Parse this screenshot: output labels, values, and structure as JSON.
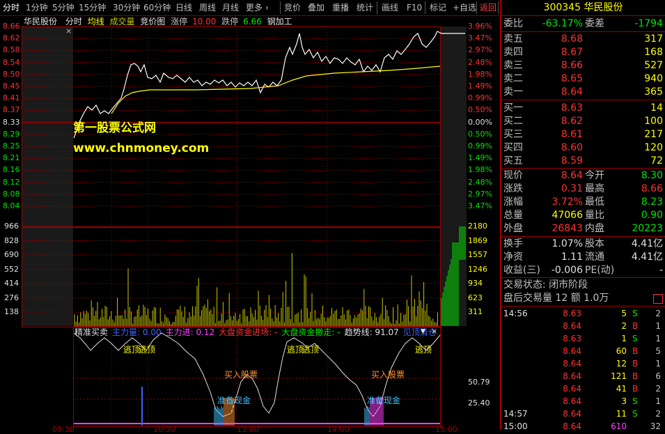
{
  "toolbar": {
    "items": [
      "分时",
      "1分钟",
      "5分钟",
      "15分钟",
      "30分钟",
      "60分钟",
      "日线",
      "周线",
      "月线",
      "更多 ›",
      "竞价",
      "叠加",
      "重播",
      "统计",
      "画线",
      "F10",
      "标记",
      "+自选",
      "返回"
    ]
  },
  "chart_header": {
    "name": "华民股份",
    "mode": "分时",
    "avg": "均线",
    "vol": "成交量",
    "auction": "竞价图",
    "limit_up_label": "涨停",
    "limit_up": "10.00",
    "limit_down_label": "跌停",
    "limit_down": "6.66",
    "sector": "钢加工"
  },
  "colors": {
    "up": "#ff3232",
    "down": "#00e600",
    "price_line": "#ffffff",
    "avg_line": "#ffff00",
    "grid": "#a00000",
    "volume": "#c8c800"
  },
  "watermark": {
    "line1": "第一股票公式网",
    "line2": "www.chnmoney.com"
  },
  "price_axis": {
    "left": [
      "8.66",
      "8.62",
      "8.58",
      "8.54",
      "8.50",
      "8.45",
      "8.41",
      "8.37",
      "8.33",
      "8.29",
      "8.25",
      "8.21",
      "8.16",
      "8.12",
      "8.08",
      "8.04"
    ],
    "right": [
      "3.96%",
      "3.47%",
      "2.97%",
      "2.48%",
      "1.98%",
      "1.49%",
      "0.99%",
      "0.50%",
      "0.00%",
      "0.50%",
      "0.99%",
      "1.49%",
      "1.98%",
      "2.48%",
      "2.97%",
      "3.47%"
    ]
  },
  "volume_axis": {
    "left": [
      "966",
      "828",
      "690",
      "552",
      "414",
      "276",
      "138"
    ],
    "right": [
      "2180",
      "1869",
      "1557",
      "1246",
      "934",
      "623",
      "311"
    ]
  },
  "indicator": {
    "name": "精准买卖",
    "items": [
      {
        "label": "主力量: 0.00",
        "color": "#4060ff"
      },
      {
        "label": "主力进: 0.12",
        "color": "#ff40ff"
      },
      {
        "label": "大盘资金进场: -",
        "color": "#ff3232"
      },
      {
        "label": "大盘资金撤走: -",
        "color": "#00e600"
      },
      {
        "label": "趋势线: 91.07",
        "color": "#e0e0e0"
      },
      {
        "label": "见顶清仓",
        "color": "#4060ff"
      }
    ],
    "axis_right": [
      "50.79",
      "25.40"
    ],
    "signals": {
      "escape": "逃顶",
      "buy": "买入股票",
      "ready": "准备现金"
    }
  },
  "time_axis": [
    "09:30",
    "10:30",
    "13:00",
    "14:00",
    "15:00"
  ],
  "quote": {
    "code": "300345",
    "name": "华民股份",
    "weibi_label": "委比",
    "weibi": "-63.17%",
    "weicha_label": "委差",
    "weicha": "-1794",
    "sells": [
      {
        "label": "卖五",
        "price": "8.68",
        "vol": "317"
      },
      {
        "label": "卖四",
        "price": "8.67",
        "vol": "168"
      },
      {
        "label": "卖三",
        "price": "8.66",
        "vol": "527"
      },
      {
        "label": "卖二",
        "price": "8.65",
        "vol": "940"
      },
      {
        "label": "卖一",
        "price": "8.64",
        "vol": "365"
      }
    ],
    "buys": [
      {
        "label": "买一",
        "price": "8.63",
        "vol": "14"
      },
      {
        "label": "买二",
        "price": "8.62",
        "vol": "100"
      },
      {
        "label": "买三",
        "price": "8.61",
        "vol": "217"
      },
      {
        "label": "买四",
        "price": "8.60",
        "vol": "120"
      },
      {
        "label": "买五",
        "price": "8.59",
        "vol": "72"
      }
    ],
    "stats": [
      {
        "l1": "现价",
        "v1": "8.64",
        "c1": "#ff3232",
        "l2": "今开",
        "v2": "8.30",
        "c2": "#00e600"
      },
      {
        "l1": "涨跌",
        "v1": "0.31",
        "c1": "#ff3232",
        "l2": "最高",
        "v2": "8.66",
        "c2": "#ff3232"
      },
      {
        "l1": "涨幅",
        "v1": "3.72%",
        "c1": "#ff3232",
        "l2": "最低",
        "v2": "8.23",
        "c2": "#00e600"
      },
      {
        "l1": "总量",
        "v1": "47066",
        "c1": "#ffff00",
        "l2": "量比",
        "v2": "0.90",
        "c2": "#00e600"
      },
      {
        "l1": "外盘",
        "v1": "26843",
        "c1": "#ff3232",
        "l2": "内盘",
        "v2": "20223",
        "c2": "#00e600"
      }
    ],
    "stats2": [
      {
        "l1": "换手",
        "v1": "1.07%",
        "l2": "股本",
        "v2": "4.41亿"
      },
      {
        "l1": "净资",
        "v1": "1.11",
        "l2": "流通",
        "v2": "4.41亿"
      },
      {
        "l1": "收益(三)",
        "v1": "-0.006",
        "l2": "PE(动)",
        "v2": "-"
      }
    ],
    "state": "交易状态: 闭市阶段",
    "after_hours": "盘后交易量 12 额 1.0万"
  },
  "ticks": [
    {
      "time": "14:56",
      "price": "8.63",
      "vol": "5",
      "side": "S",
      "n": "2"
    },
    {
      "time": "",
      "price": "8.64",
      "vol": "2",
      "side": "B",
      "n": "1"
    },
    {
      "time": "",
      "price": "8.63",
      "vol": "1",
      "side": "S",
      "n": "1"
    },
    {
      "time": "",
      "price": "8.64",
      "vol": "60",
      "side": "B",
      "n": "5"
    },
    {
      "time": "",
      "price": "8.64",
      "vol": "12",
      "side": "B",
      "n": "1"
    },
    {
      "time": "",
      "price": "8.64",
      "vol": "121",
      "side": "B",
      "n": "6"
    },
    {
      "time": "",
      "price": "8.64",
      "vol": "41",
      "side": "B",
      "n": "2"
    },
    {
      "time": "",
      "price": "8.64",
      "vol": "3",
      "side": "S",
      "n": "1"
    },
    {
      "time": "14:57",
      "price": "8.64",
      "vol": "11",
      "side": "S",
      "n": "2"
    },
    {
      "time": "15:00",
      "price": "8.64",
      "vol": "610",
      "side": "",
      "n": "32"
    }
  ]
}
